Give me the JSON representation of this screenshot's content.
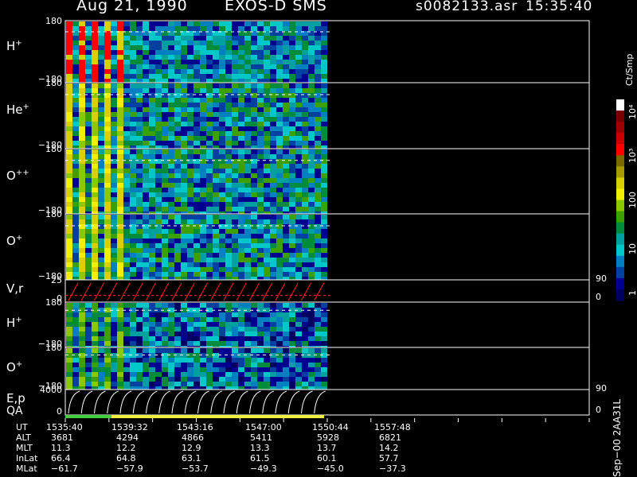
{
  "header": {
    "date": "Aug 21, 1990",
    "instrument": "EXOS-D SMS",
    "file": "s0082133.asr",
    "time": "15:35:40"
  },
  "panels": [
    {
      "label": "H",
      "charge": "+",
      "top": "180",
      "bottom": "−180"
    },
    {
      "label": "He",
      "charge": "+",
      "top": "180",
      "bottom": "−180"
    },
    {
      "label": "O",
      "charge": "++",
      "top": "180",
      "bottom": "−180"
    },
    {
      "label": "O",
      "charge": "+",
      "top": "180",
      "bottom": "−180"
    },
    {
      "label": "V,r",
      "charge": "",
      "top": "25",
      "bottom": "0",
      "right_top": "90",
      "right_bottom": "0"
    },
    {
      "label": "H",
      "charge": "+",
      "top": "180",
      "bottom": "−180"
    },
    {
      "label": "O",
      "charge": "+",
      "top": "180",
      "bottom": "−180"
    },
    {
      "label": "E,p",
      "charge": "",
      "top": "4000",
      "bottom": "0",
      "right_top": "90",
      "right_bottom": "0"
    }
  ],
  "qa_label": "QA",
  "colorbar": {
    "unit": "Ct/Smp",
    "ticks": [
      "10⁴",
      "10³",
      "100",
      "10",
      "1"
    ],
    "colors": [
      "#ffffff",
      "#7a0000",
      "#a00000",
      "#cc0000",
      "#ff0000",
      "#7a6a00",
      "#a89a00",
      "#d8d000",
      "#f0f000",
      "#8cc800",
      "#3ca000",
      "#008c3c",
      "#00a0a0",
      "#00c8c8",
      "#0080c0",
      "#0040a0",
      "#000090",
      "#000060"
    ]
  },
  "ephemeris": {
    "labels": [
      "UT",
      "ALT",
      "MLT",
      "InLat",
      "MLat"
    ],
    "columns": [
      {
        "UT": "1535:40",
        "ALT": "3681",
        "MLT": "11.3",
        "InLat": "66.4",
        "MLat": "−61.7"
      },
      {
        "UT": "1539:32",
        "ALT": "4294",
        "MLT": "12.2",
        "InLat": "64.8",
        "MLat": "−57.9"
      },
      {
        "UT": "1543:16",
        "ALT": "4866",
        "MLT": "12.9",
        "InLat": "63.1",
        "MLat": "−53.7"
      },
      {
        "UT": "1547:00",
        "ALT": "5411",
        "MLT": "13.3",
        "InLat": "61.5",
        "MLat": "−49.3"
      },
      {
        "UT": "1550:44",
        "ALT": "5928",
        "MLT": "13.7",
        "InLat": "60.1",
        "MLat": "−45.0"
      },
      {
        "UT": "1557:48",
        "ALT": "6821",
        "MLT": "14.2",
        "InLat": "57.7",
        "MLat": "−37.3"
      }
    ]
  },
  "footer_vertical": "Sep−00 2AA31L",
  "chart_data": {
    "type": "heatmap",
    "title": "Aug 21, 1990 EXOS-D SMS",
    "xlabel": "UT",
    "x_ticks": [
      "1535:40",
      "1539:32",
      "1543:16",
      "1547:00",
      "1550:44",
      "1557:48"
    ],
    "data_coverage_ut": [
      "1535:40",
      "1550:44"
    ],
    "series": [
      {
        "name": "H+",
        "ylim": [
          -180,
          180
        ],
        "scale": "log counts"
      },
      {
        "name": "He+",
        "ylim": [
          -180,
          180
        ],
        "scale": "log counts"
      },
      {
        "name": "O++",
        "ylim": [
          -180,
          180
        ],
        "scale": "log counts"
      },
      {
        "name": "O+",
        "ylim": [
          -180,
          180
        ],
        "scale": "log counts"
      },
      {
        "name": "V,r",
        "ylim": [
          0,
          25
        ],
        "right_ylim": [
          0,
          90
        ]
      },
      {
        "name": "H+",
        "ylim": [
          -180,
          180
        ],
        "scale": "log counts"
      },
      {
        "name": "O+",
        "ylim": [
          -180,
          180
        ],
        "scale": "log counts"
      },
      {
        "name": "E,p",
        "ylim": [
          0,
          4000
        ],
        "right_ylim": [
          0,
          90
        ]
      }
    ],
    "colorbar_range": [
      1,
      10000
    ],
    "spin_sweeps": 20
  }
}
